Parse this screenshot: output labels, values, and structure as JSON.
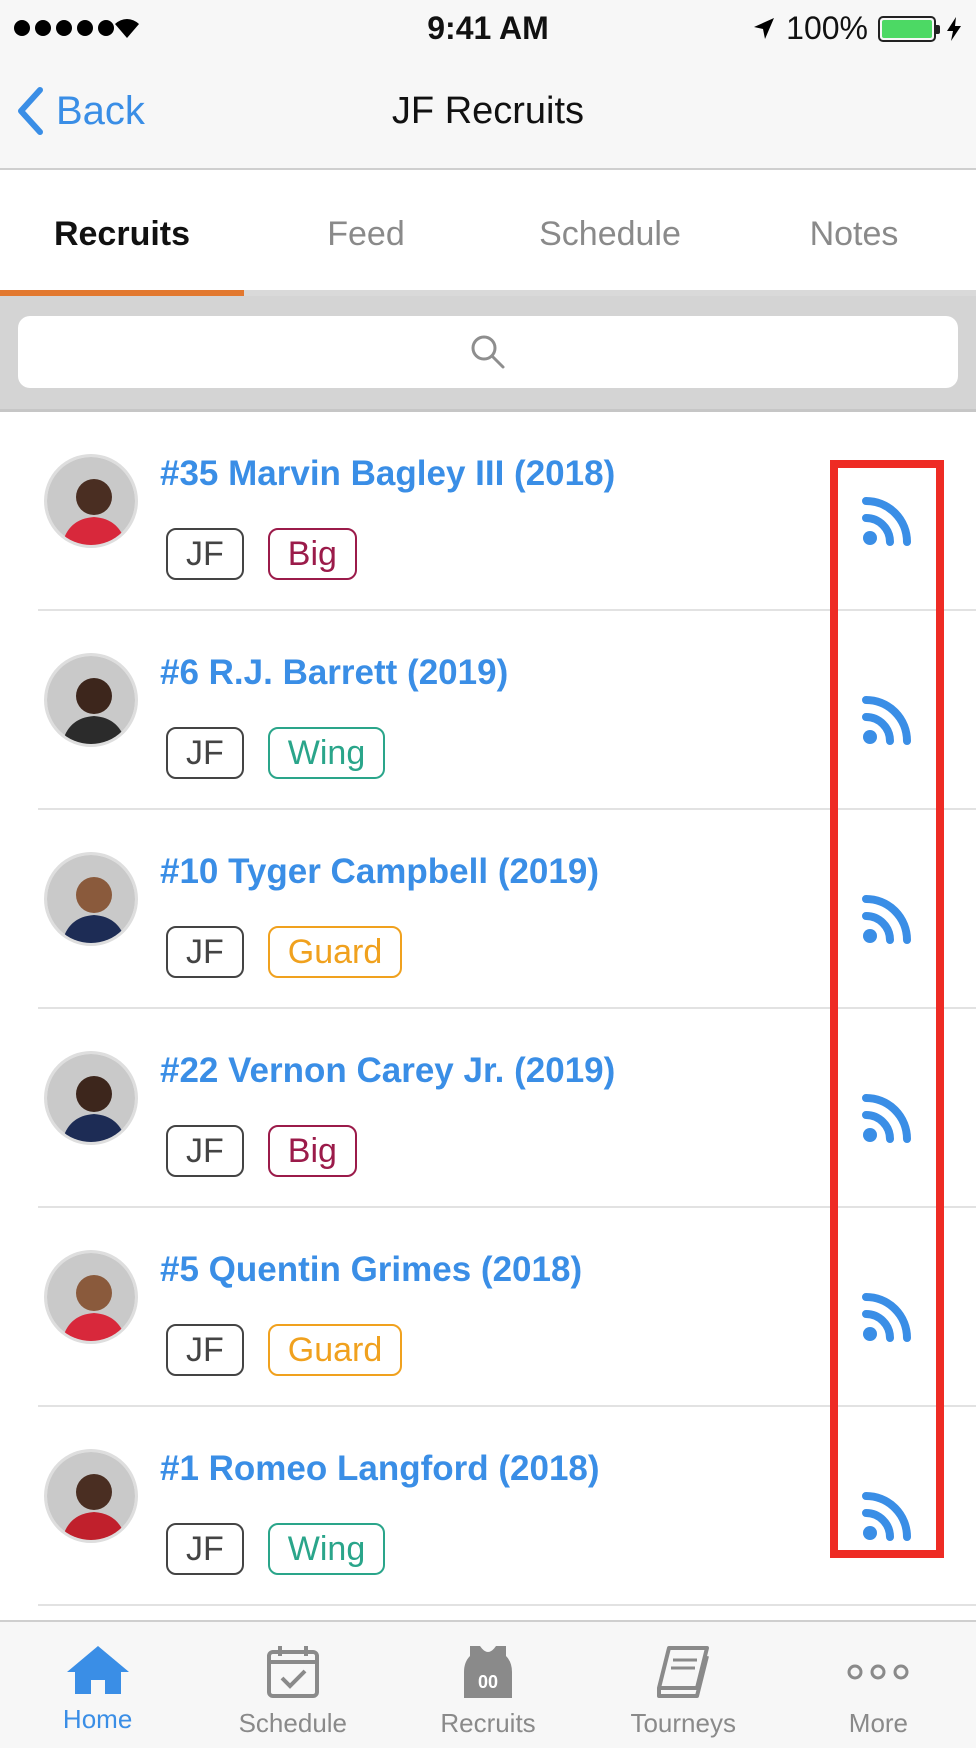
{
  "status_bar": {
    "time": "9:41 AM",
    "battery": "100%",
    "icons": [
      "signal-dots-icon",
      "wifi-icon",
      "location-arrow-icon",
      "battery-icon",
      "charging-bolt-icon"
    ]
  },
  "nav": {
    "back_label": "Back",
    "title": "JF Recruits"
  },
  "tabs": [
    {
      "label": "Recruits",
      "active": true
    },
    {
      "label": "Feed",
      "active": false
    },
    {
      "label": "Schedule",
      "active": false
    },
    {
      "label": "Notes",
      "active": false
    }
  ],
  "search": {
    "placeholder": "",
    "icon": "search-icon"
  },
  "recruits": [
    {
      "name": "#35 Marvin Bagley III (2018)",
      "tags": [
        {
          "label": "JF",
          "color": "#444444"
        },
        {
          "label": "Big",
          "color": "#9b1b4a"
        }
      ],
      "jersey": "#d8283b",
      "skin": "#4a2e22"
    },
    {
      "name": "#6 R.J. Barrett (2019)",
      "tags": [
        {
          "label": "JF",
          "color": "#444444"
        },
        {
          "label": "Wing",
          "color": "#2aa58a"
        }
      ],
      "jersey": "#2b2b2b",
      "skin": "#3d261c"
    },
    {
      "name": "#10 Tyger Campbell (2019)",
      "tags": [
        {
          "label": "JF",
          "color": "#444444"
        },
        {
          "label": "Guard",
          "color": "#f0a11e"
        }
      ],
      "jersey": "#1d2c55",
      "skin": "#8a5a3c"
    },
    {
      "name": "#22 Vernon Carey Jr. (2019)",
      "tags": [
        {
          "label": "JF",
          "color": "#444444"
        },
        {
          "label": "Big",
          "color": "#9b1b4a"
        }
      ],
      "jersey": "#1d2c55",
      "skin": "#3d261c"
    },
    {
      "name": "#5 Quentin Grimes (2018)",
      "tags": [
        {
          "label": "JF",
          "color": "#444444"
        },
        {
          "label": "Guard",
          "color": "#f0a11e"
        }
      ],
      "jersey": "#d8283b",
      "skin": "#8a5a3c"
    },
    {
      "name": "#1 Romeo Langford (2018)",
      "tags": [
        {
          "label": "JF",
          "color": "#444444"
        },
        {
          "label": "Wing",
          "color": "#2aa58a"
        }
      ],
      "jersey": "#c0202c",
      "skin": "#4a2e22"
    }
  ],
  "row_action_icon": "feed-rss-icon",
  "tab_bar": [
    {
      "label": "Home",
      "icon": "home-icon",
      "active": true
    },
    {
      "label": "Schedule",
      "icon": "calendar-check-icon",
      "active": false
    },
    {
      "label": "Recruits",
      "icon": "jersey-icon",
      "jersey_number": "00",
      "active": false
    },
    {
      "label": "Tourneys",
      "icon": "book-icon",
      "active": false
    },
    {
      "label": "More",
      "icon": "more-dots-icon",
      "active": false
    }
  ],
  "colors": {
    "accent": "#3a8ee6",
    "tab_indicator": "#e2782f",
    "highlight": "#ee2b24"
  }
}
